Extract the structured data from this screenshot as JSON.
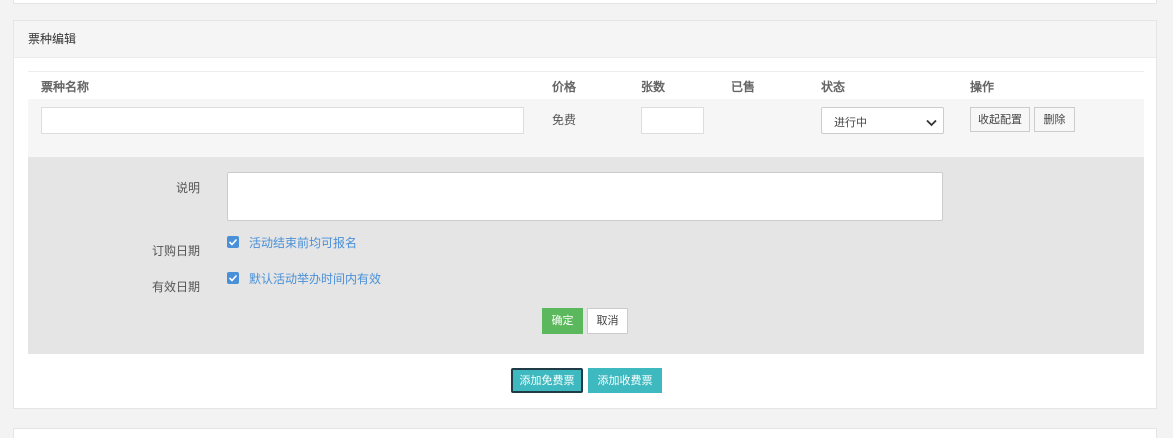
{
  "panel": {
    "title": "票种编辑"
  },
  "table": {
    "headers": {
      "name": "票种名称",
      "price": "价格",
      "quantity": "张数",
      "sold": "已售",
      "status": "状态",
      "actions": "操作"
    },
    "row": {
      "name_value": "",
      "price": "免费",
      "quantity_value": "",
      "sold": "",
      "status_selected": "进行中",
      "collapse_label": "收起配置",
      "delete_label": "删除"
    }
  },
  "detail": {
    "description_label": "说明",
    "description_value": "",
    "order_date_label": "订购日期",
    "order_date_option": "活动结束前均可报名",
    "order_date_checked": true,
    "valid_date_label": "有效日期",
    "valid_date_option": "默认活动举办时间内有效",
    "valid_date_checked": true,
    "confirm_label": "确定",
    "cancel_label": "取消"
  },
  "footer": {
    "add_free_label": "添加免费票",
    "add_paid_label": "添加收费票"
  },
  "colors": {
    "confirm": "#5cb85c",
    "add_buttons": "#3db9bf",
    "checkbox": "#4a90d9",
    "detail_bg": "#e5e5e5"
  }
}
